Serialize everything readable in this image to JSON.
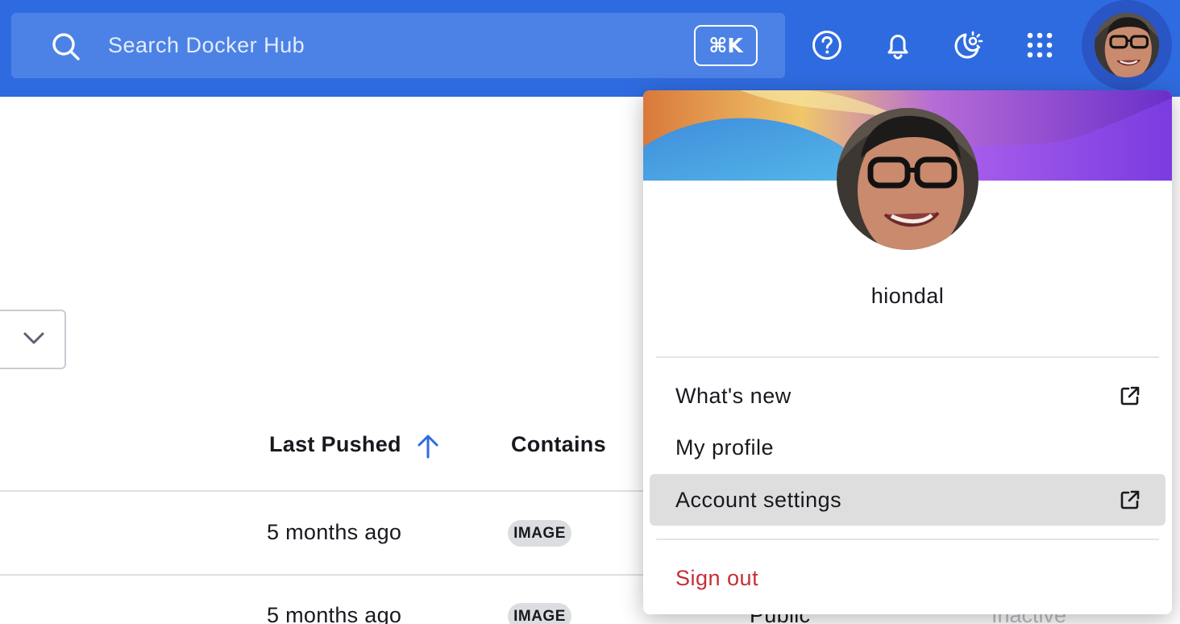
{
  "search": {
    "placeholder": "Search Docker Hub",
    "shortcut": "⌘K"
  },
  "topbar": {
    "icons": [
      "help-icon",
      "bell-icon",
      "theme-icon",
      "apps-grid-icon"
    ],
    "accent": "#2f6be0"
  },
  "table": {
    "headers": {
      "last_pushed": "Last Pushed",
      "contains": "Contains"
    },
    "rows": [
      {
        "last_pushed": "5 months ago",
        "contains": "IMAGE"
      },
      {
        "last_pushed": "5 months ago",
        "contains": "IMAGE",
        "visibility": "Public",
        "status": "Inactive"
      }
    ]
  },
  "profile_menu": {
    "username": "hiondal",
    "items": [
      {
        "label": "What's new",
        "external": true
      },
      {
        "label": "My profile",
        "external": false
      },
      {
        "label": "Account settings",
        "external": true,
        "highlighted": true
      }
    ],
    "sign_out": "Sign out",
    "sign_out_color": "#c62f38"
  }
}
